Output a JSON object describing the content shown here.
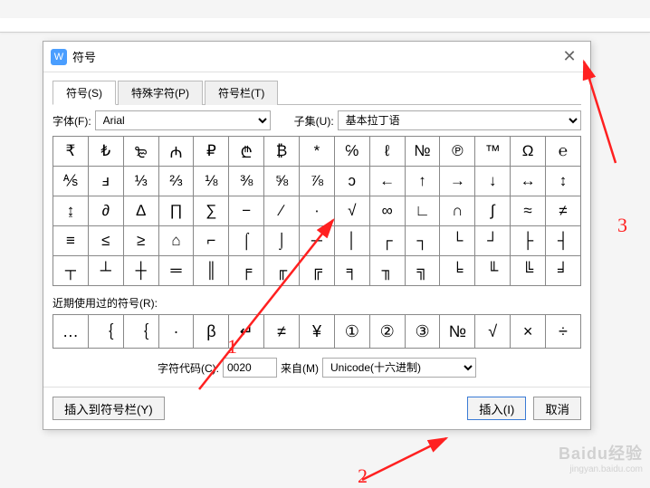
{
  "window": {
    "icon_letter": "W",
    "title": "符号"
  },
  "tabs": [
    {
      "label": "符号(S)",
      "active": true
    },
    {
      "label": "特殊字符(P)",
      "active": false
    },
    {
      "label": "符号栏(T)",
      "active": false
    }
  ],
  "font": {
    "label": "字体(F):",
    "value": "Arial"
  },
  "subset": {
    "label": "子集(U):",
    "value": "基本拉丁语"
  },
  "grid": [
    [
      "₹",
      "₺",
      "₻",
      "₼",
      "₽",
      "₾",
      "₿",
      "*",
      "℅",
      "ℓ",
      "№",
      "℗",
      "™",
      "Ω",
      "℮"
    ],
    [
      "⅍",
      "ⅎ",
      "⅓",
      "⅔",
      "⅛",
      "⅜",
      "⅝",
      "⅞",
      "ↄ",
      "←",
      "↑",
      "→",
      "↓",
      "↔",
      "↕"
    ],
    [
      "↨",
      "∂",
      "∆",
      "∏",
      "∑",
      "−",
      "∕",
      "∙",
      "√",
      "∞",
      "∟",
      "∩",
      "∫",
      "≈",
      "≠"
    ],
    [
      "≡",
      "≤",
      "≥",
      "⌂",
      "⌐",
      "⌠",
      "⌡",
      "─",
      "│",
      "┌",
      "┐",
      "└",
      "┘",
      "├",
      "┤"
    ],
    [
      "┬",
      "┴",
      "┼",
      "═",
      "║",
      "╒",
      "╓",
      "╔",
      "╕",
      "╖",
      "╗",
      "╘",
      "╙",
      "╚",
      "╛"
    ]
  ],
  "recent": {
    "label": "近期使用过的符号(R):",
    "items": [
      "…",
      "｛",
      "｛",
      "·",
      "β",
      "↵",
      "≠",
      "¥",
      "①",
      "②",
      "③",
      "№",
      "√",
      "×",
      "÷"
    ]
  },
  "code": {
    "label": "字符代码(C):",
    "value": "0020",
    "from_label": "来自(M)",
    "from_value": "Unicode(十六进制)"
  },
  "buttons": {
    "insert_to_bar": "插入到符号栏(Y)",
    "insert": "插入(I)",
    "cancel": "取消"
  },
  "annotations": {
    "n1": "1",
    "n2": "2",
    "n3": "3"
  },
  "watermark": {
    "line1": "Baidu经验",
    "line2": "jingyan.baidu.com"
  }
}
